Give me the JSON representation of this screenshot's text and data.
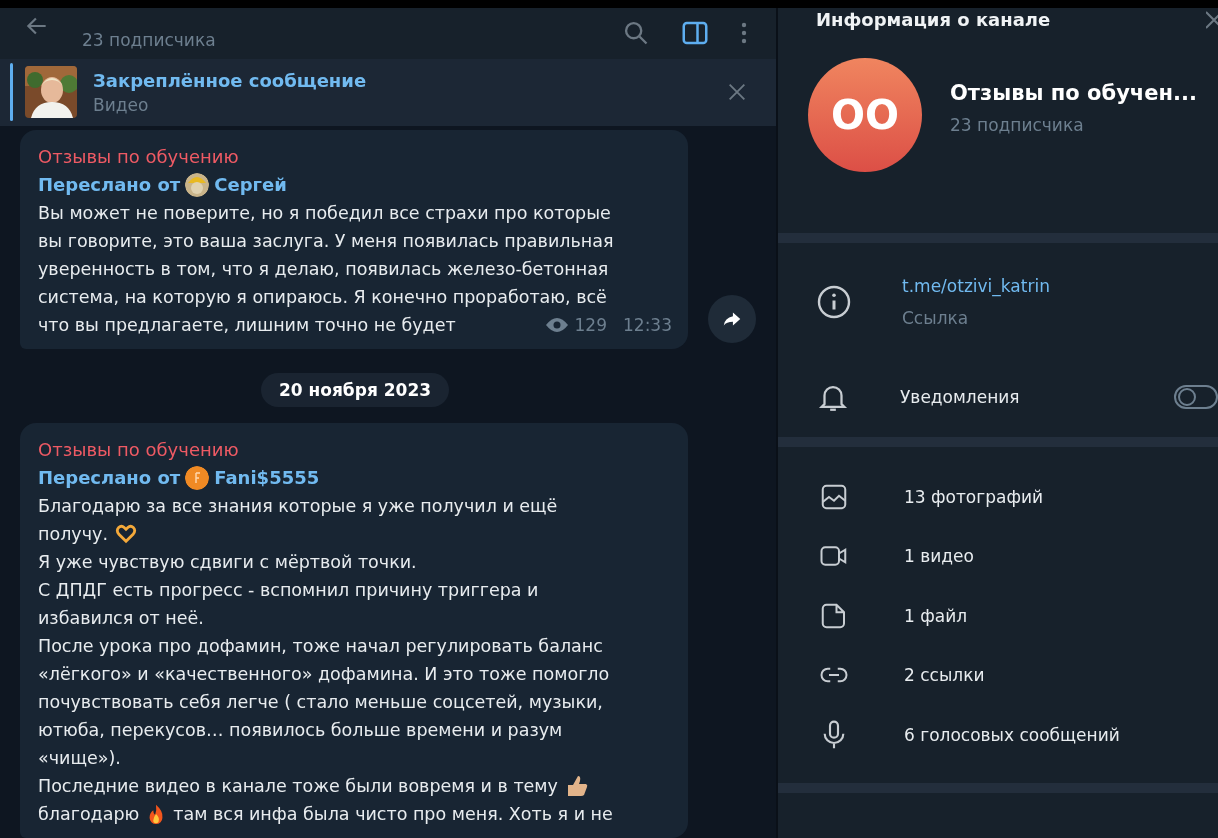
{
  "chat_header": {
    "subtitle": "23 подписчика"
  },
  "pinned": {
    "title": "Закреплённое сообщение",
    "subtitle": "Видео",
    "thumbnail": {
      "kind": "picture"
    }
  },
  "messages": [
    {
      "kind": "post",
      "channel": "Отзывы по обучению",
      "forwarded_label": "Переслано от",
      "forwarded_from": "Сергей",
      "avatar": {
        "kind": "picture"
      },
      "lines": [
        [
          {
            "text": "Вы может не поверите, но я победил все страхи про которые"
          }
        ],
        [
          {
            "text": "вы говорите, это ваша заслуга. У меня появилась правильная"
          }
        ],
        [
          {
            "text": "уверенность в том, что я делаю, появилась железо-бетонная"
          }
        ],
        [
          {
            "text": "система, на которую я опираюсь. Я конечно проработаю, всё"
          }
        ],
        [
          {
            "text": "что вы предлагаете, лишним точно не будет"
          }
        ]
      ],
      "views": "129",
      "time": "12:33",
      "share": true
    },
    {
      "kind": "date",
      "text": "20 ноября 2023"
    },
    {
      "kind": "post",
      "channel": "Отзывы по обучению",
      "forwarded_label": "Переслано от",
      "forwarded_from": "Fani$5555",
      "avatar": {
        "kind": "letter"
      },
      "lines": [
        [
          {
            "text": "Благодарю за все знания которые я уже получил и ещё"
          }
        ],
        [
          {
            "text": "получу."
          },
          {
            "kind": "heart"
          }
        ],
        [
          {
            "text": "Я уже чувствую сдвиги с мёртвой точки."
          }
        ],
        [
          {
            "text": "С ДПДГ есть прогресс - вспомнил причину триггера и"
          }
        ],
        [
          {
            "text": "избавился от неё."
          }
        ],
        [
          {
            "text": "После урока про дофамин, тоже начал регулировать баланс"
          }
        ],
        [
          {
            "text": "«лёгкого» и «качественного» дофамина. И это тоже помогло"
          }
        ],
        [
          {
            "text": "почувствовать себя легче ( стало меньше соцсетей, музыки,"
          }
        ],
        [
          {
            "text": "ютюба, перекусов… появилось больше времени и разум"
          }
        ],
        [
          {
            "text": "«чище»)."
          }
        ],
        [
          {
            "text": "Последние видео в канале тоже были вовремя и в тему"
          },
          {
            "kind": "thumbsup"
          }
        ],
        [
          {
            "text": "благодарю"
          },
          {
            "kind": "fire"
          },
          {
            "text": "там вся инфа была чисто про меня. Хоть я и не"
          }
        ]
      ],
      "share": false
    }
  ],
  "info_panel": {
    "title": "Информация о канале",
    "avatar_initials": "ОО",
    "name": "Отзывы по обучен...",
    "subscribers": "23 подписчика",
    "link": "t.me/otzivi_katrin",
    "link_label": "Ссылка",
    "notifications_label": "Уведомления",
    "notifications_on": false,
    "media": [
      {
        "kind": "photos",
        "label": "13 фотографий"
      },
      {
        "kind": "video",
        "label": "1 видео"
      },
      {
        "kind": "file",
        "label": "1 файл"
      },
      {
        "kind": "links",
        "label": "2 ссылки"
      },
      {
        "kind": "voice",
        "label": "6 голосовых сообщений"
      }
    ]
  }
}
